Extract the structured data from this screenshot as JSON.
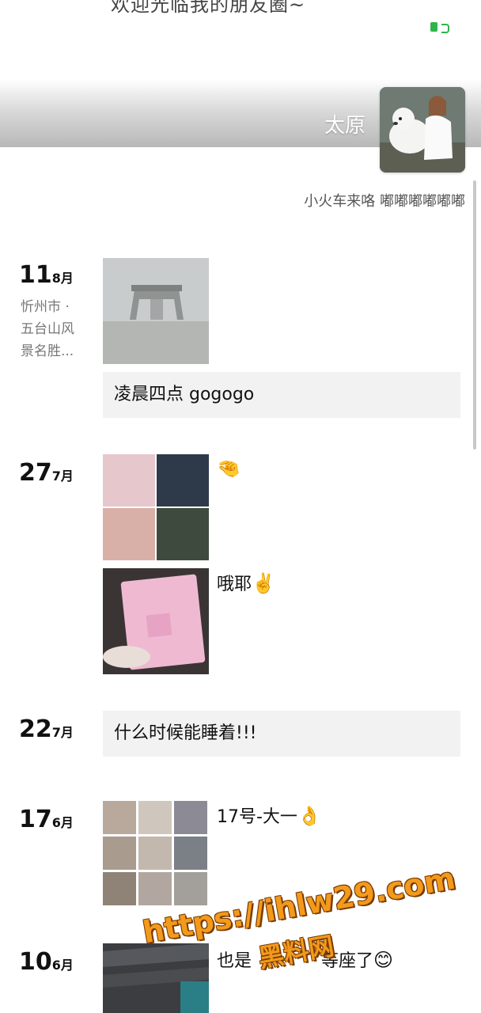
{
  "cover": {
    "title": "欢迎光临我的朋友圈~",
    "nickname": "太原"
  },
  "signature": "小火车来咯 嘟嘟嘟嘟嘟嘟",
  "posts": [
    {
      "day": "11",
      "month": "8月",
      "location": "忻州市 · 五台山风景名胜...",
      "text": "凌晨四点 gogogo"
    },
    {
      "day": "27",
      "month": "7月",
      "items": [
        {
          "caption": "",
          "emoji": "🤏"
        },
        {
          "caption": "哦耶",
          "emoji": "✌️"
        }
      ]
    },
    {
      "day": "22",
      "month": "7月",
      "text": "什么时候能睡着!!!"
    },
    {
      "day": "17",
      "month": "6月",
      "caption": "17号-大一",
      "emoji": "👌"
    },
    {
      "day": "10",
      "month": "6月",
      "caption": "也是",
      "caption_tail": "等座了",
      "emoji": "😊"
    }
  ],
  "watermark": {
    "line1": "https://ihlw29.com",
    "line2": "黑料网"
  },
  "colors": {
    "accent_green": "#2fb44a",
    "textcard_bg": "#f2f2f2",
    "watermark_orange": "#f39a1c"
  }
}
